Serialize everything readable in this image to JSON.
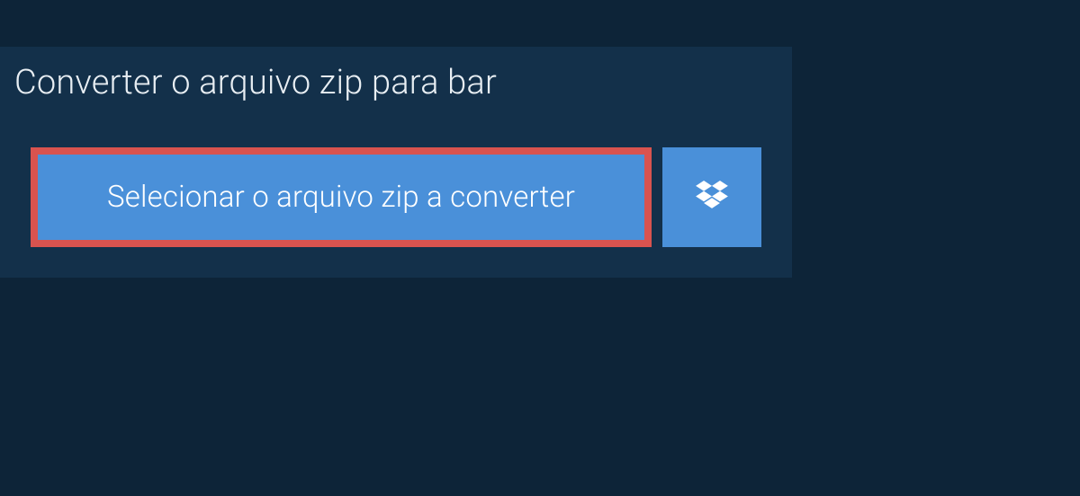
{
  "title": "Converter o arquivo zip para bar",
  "buttons": {
    "select_label": "Selecionar o arquivo zip a converter",
    "dropbox_icon": "dropbox"
  }
}
